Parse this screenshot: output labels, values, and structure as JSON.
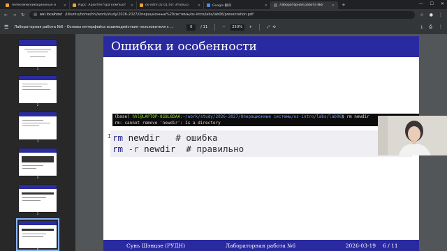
{
  "browser": {
    "tabs": [
      {
        "title": "Телекоммуникационные и",
        "color": "#e8a33d",
        "active": false
      },
      {
        "title": "Курс: Архитектура компьют",
        "color": "#e8a33d",
        "active": false
      },
      {
        "title": "os-intro 02.01.00: Этапы р",
        "color": "#e8a33d",
        "active": false
      },
      {
        "title": "Google 翻译",
        "color": "#4a8af4",
        "active": false
      },
      {
        "title": "Лабораторная работа №6",
        "color": "#6b6b6b",
        "active": true
      }
    ],
    "url_host": "wsl.localhost",
    "url_path": "/Ubuntu/home/hhl/work/study/2026-2027/Операционные%20системы/os-intro/labs/lab06/presentation.pdf"
  },
  "pdf_toolbar": {
    "title": "Лабораторная работа №6 - Основы интерфейса взаимодействия пользователя с си...",
    "current_page": "6",
    "page_total": "/ 11",
    "zoom": "250%"
  },
  "sidebar": {
    "pages": [
      "1",
      "2",
      "3",
      "4",
      "5",
      "6"
    ],
    "selected": "6"
  },
  "slide": {
    "heading": "Ошибки и особенности",
    "terminal": {
      "line1_env": "(base)",
      "line1_user": "hhl@LAPTOP-8SBL8DAA",
      "line1_path": ":~/work/study/2026-2027/Операционные системы/os-intro/labs/lab06",
      "line1_prompt": "$ rm newdir",
      "line2": "rm: cannot remove 'newdir': Is a directory"
    },
    "code": [
      {
        "cmd": "rm",
        "opt": "",
        "arg": " newdir",
        "comment": "   # ошибка"
      },
      {
        "cmd": "rm",
        "opt": " -r",
        "arg": " newdir",
        "comment": "  # правильно"
      }
    ],
    "footer": {
      "author": "Сунь Шэнцзе  (РУДН)",
      "title": "Лабораторная работа №6",
      "date": "2026-03-19",
      "page": "6 / 11"
    }
  }
}
